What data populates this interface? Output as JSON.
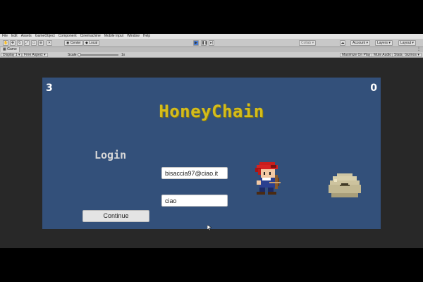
{
  "menu": [
    "File",
    "Edit",
    "Assets",
    "GameObject",
    "Component",
    "Cinemachine",
    "Mobile Input",
    "Window",
    "Help"
  ],
  "toolbar": {
    "center_label": "Center",
    "local_label": "Local",
    "collab_label": "Collab",
    "account_label": "Account",
    "layers_label": "Layers",
    "layout_label": "Layout"
  },
  "tab": {
    "label": "Game"
  },
  "gamebar": {
    "display": "Display 1",
    "aspect": "Free Aspect",
    "scale_label": "Scale",
    "scale_value": "1x",
    "maximize": "Maximize On Play",
    "mute": "Mute Audio",
    "stats": "Stats",
    "gizmos": "Gizmos"
  },
  "game": {
    "score_left": "3",
    "score_right": "0",
    "title": "HoneyChain",
    "login_label": "Login",
    "email_value": "bisaccia97@ciao.it",
    "password_value": "ciao",
    "continue_label": "Continue"
  },
  "colors": {
    "game_background": "#33507a",
    "title_yellow": "#d4bc1c",
    "play_blue": "#4a7fd6"
  }
}
